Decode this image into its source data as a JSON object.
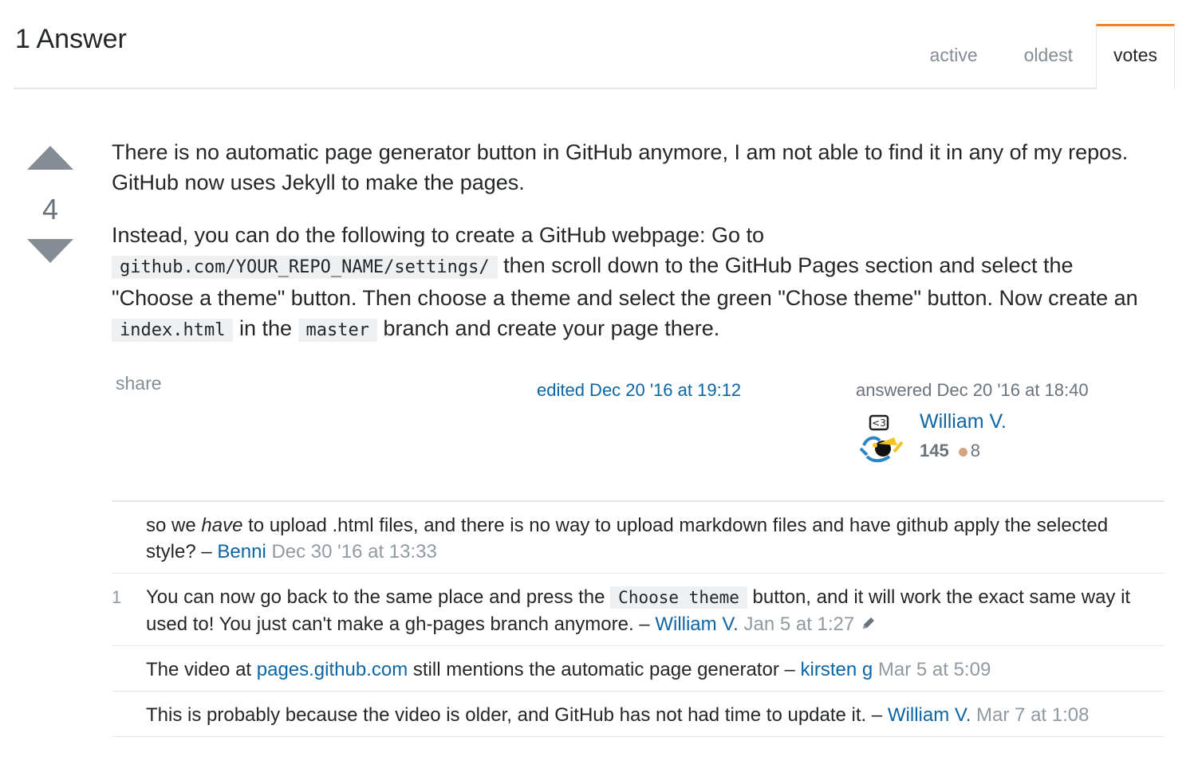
{
  "header": {
    "title": "1 Answer",
    "tabs": [
      {
        "label": "active"
      },
      {
        "label": "oldest"
      },
      {
        "label": "votes",
        "selected": true
      }
    ]
  },
  "answer": {
    "vote_count": "4",
    "paragraph1": "There is no automatic page generator button in GitHub anymore, I am not able to find it in any of my repos. GitHub now uses Jekyll to make the pages.",
    "p2_text1": "Instead, you can do the following to create a GitHub webpage: Go to ",
    "p2_code1": "github.com/YOUR_REPO_NAME/settings/",
    "p2_text2": " then scroll down to the GitHub Pages section and select the \"Choose a theme\" button. Then choose a theme and select the green \"Chose theme\" button. Now create an ",
    "p2_code2": "index.html",
    "p2_text3": " in the ",
    "p2_code3": "master",
    "p2_text4": " branch and create your page there.",
    "share_label": "share",
    "edited_label": "edited Dec 20 '16 at 19:12",
    "answered_label": "answered Dec 20 '16 at 18:40",
    "user": {
      "name": "William V.",
      "reputation": "145",
      "bronze_badges": "8",
      "avatar_icon": "identicon-avatar-icon"
    }
  },
  "comments": {
    "c1": {
      "score": "",
      "text_before": "so we ",
      "text_em": "have",
      "text_after": " to upload .html files, and there is no way to upload markdown files and have github apply the selected style? – ",
      "user": "Benni",
      "date": "Dec 30 '16 at 13:33"
    },
    "c2": {
      "score": "1",
      "text_before": "You can now go back to the same place and press the ",
      "code": "Choose theme",
      "text_after": " button, and it will work the exact same way it used to! You just can't make a gh-pages branch anymore. – ",
      "user": "William V.",
      "date": "Jan 5 at 1:27",
      "edited_icon": "pencil-icon"
    },
    "c3": {
      "score": "",
      "text_before": "The video at ",
      "link": "pages.github.com",
      "text_after": " still mentions the automatic page generator – ",
      "user": "kirsten g",
      "date": "Mar 5 at 5:09"
    },
    "c4": {
      "score": "",
      "text": "This is probably because the video is older, and GitHub has not had time to update it. – ",
      "user": "William V.",
      "date": "Mar 7 at 1:08"
    }
  },
  "colors": {
    "link": "#0c65a5",
    "tab_accent": "#f48024",
    "muted": "#848d95",
    "code_bg": "#eff0f1",
    "bronze": "#d1a684"
  }
}
